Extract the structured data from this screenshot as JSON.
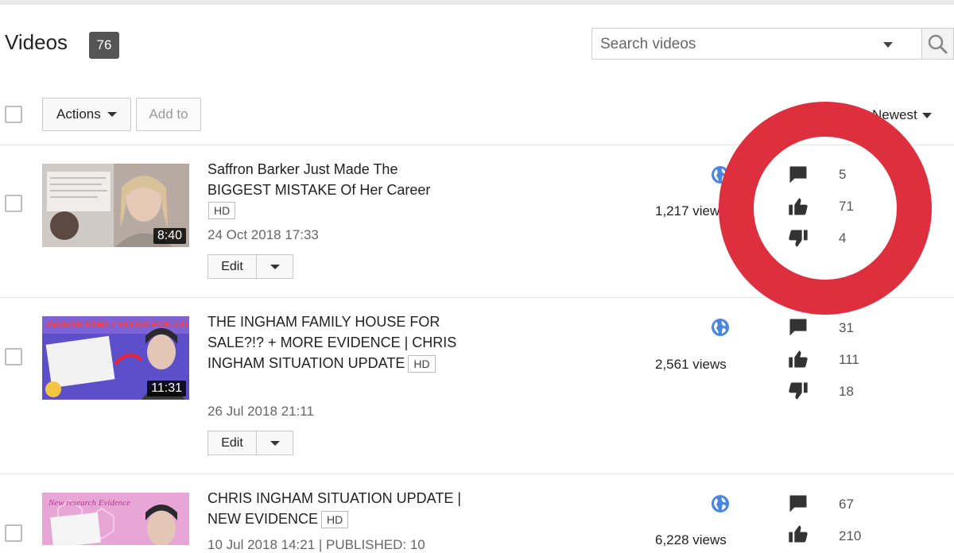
{
  "header": {
    "title": "Videos",
    "count": "76",
    "search_placeholder": "Search videos"
  },
  "toolbar": {
    "actions_label": "Actions",
    "add_to_label": "Add to",
    "sort_label": "Newest"
  },
  "edit_label": "Edit",
  "hd_label": "HD",
  "colors": {
    "highlight_ring": "#de2f3e",
    "globe": "#4a86e0",
    "count_badge": "#555555"
  },
  "videos": [
    {
      "title": "Saffron Barker Just Made The BIGGEST MISTAKE Of Her Career",
      "duration": "8:40",
      "date": "24 Oct 2018 17:33",
      "views": "1,217 views",
      "comments": "5",
      "likes": "71",
      "dislikes": "4"
    },
    {
      "title": "THE INGHAM FAMILY HOUSE FOR SALE?!? + MORE EVIDENCE | CHRIS INGHAM SITUATION UPDATE",
      "duration": "11:31",
      "date": "26 Jul 2018 21:11",
      "views": "2,561 views",
      "comments": "31",
      "likes": "111",
      "dislikes": "18",
      "thumb_text": "INGHAM FAMILY HOUSE FOR SALE"
    },
    {
      "title": "CHRIS INGHAM SITUATION UPDATE | NEW EVIDENCE",
      "date": "10 Jul 2018 14:21 | PUBLISHED: 10",
      "views": "6,228 views",
      "comments": "67",
      "likes": "210",
      "thumb_text": "New research Evidence"
    }
  ]
}
